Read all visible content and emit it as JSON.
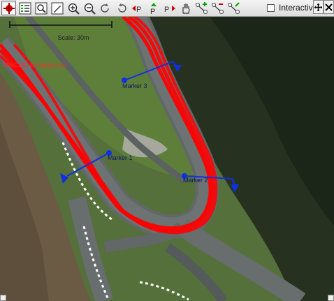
{
  "toolbar": {
    "icons": [
      "crosshair-red-icon",
      "layers-list-icon",
      "zoom-fit-icon",
      "draw-icon",
      "zoom-in-icon",
      "zoom-out-icon",
      "rotate-cw-icon",
      "rotate-ccw-icon",
      "previous-marker-icon",
      "place-marker-icon",
      "next-marker-icon",
      "pan-hand-icon",
      "add-waypoint-icon",
      "remove-waypoint-icon",
      "edit-waypoint-icon"
    ],
    "interactive_label": "Interactive"
  },
  "map": {
    "scale_label": "Scale: 30m",
    "run_label": "20SCIAL complete run",
    "markers": [
      {
        "label": "Marker 3"
      },
      {
        "label": "Marker 1"
      },
      {
        "label": "Marker 2"
      }
    ],
    "colors": {
      "run_line": "#ff0000",
      "marker": "#1030e0",
      "track": "#5f6466",
      "grass": "#4f6e30",
      "forest": "#1f2a19"
    }
  }
}
